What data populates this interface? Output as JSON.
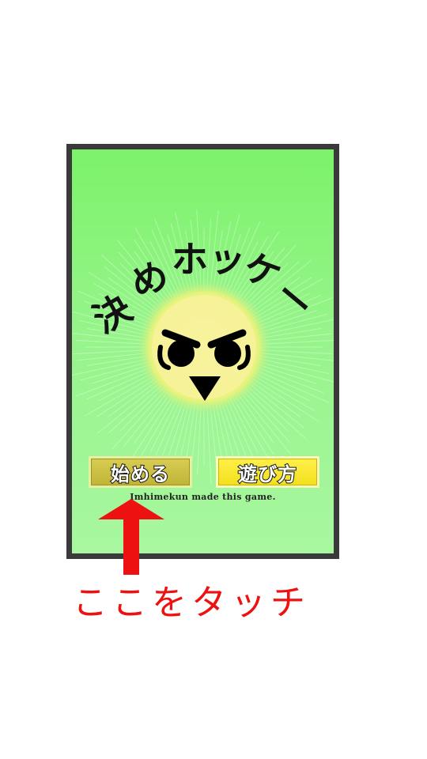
{
  "colors": {
    "frame_border": "#3a3a3a",
    "background_top": "#7cf26a",
    "background_bottom": "#a8f7a0",
    "face_glow": "#fff8a0",
    "start_button": "#c8bc3c",
    "howto_button": "#f7e42a",
    "hint_red": "#ee1111"
  },
  "game": {
    "title": "決めホッケー",
    "title_chars": [
      "決",
      "め",
      "ホ",
      "ッ",
      "ケ",
      "ー"
    ],
    "mascot_icon": "angry-face-icon",
    "start_label": "始める",
    "howto_label": "遊び方",
    "credit": "Imhimekun made this game."
  },
  "hint": {
    "arrow_icon": "up-arrow-icon",
    "text": "ここをタッチ"
  }
}
